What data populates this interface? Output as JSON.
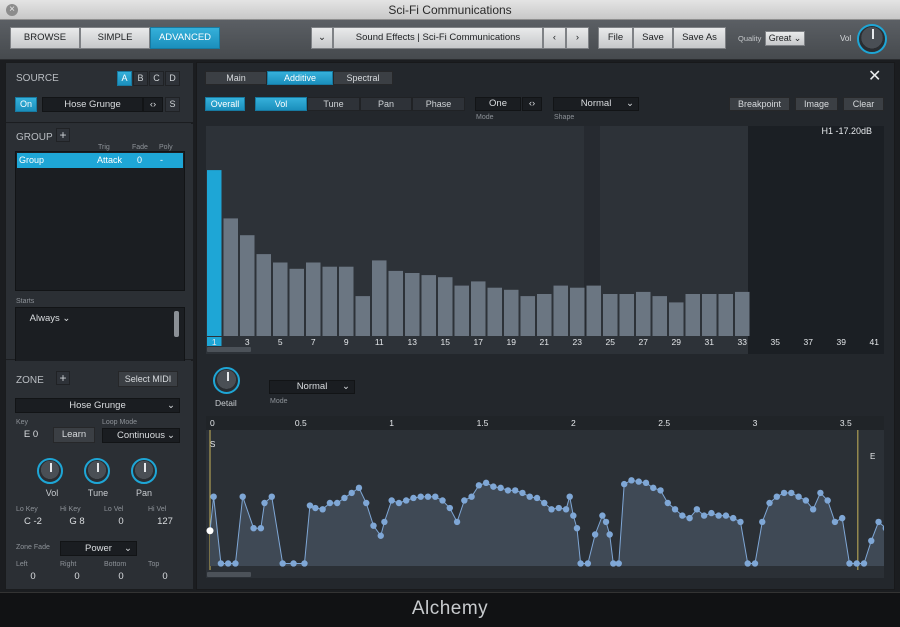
{
  "window": {
    "title": "Sci-Fi Communications"
  },
  "topbar": {
    "tabs": [
      "BROWSE",
      "SIMPLE",
      "ADVANCED"
    ],
    "preset_name": "Sound Effects | Sci-Fi Communications",
    "file_label": "File",
    "save_label": "Save",
    "save_as_label": "Save As",
    "quality_label": "Quality",
    "quality_value": "Great",
    "vol_label": "Vol"
  },
  "source": {
    "heading": "SOURCE",
    "slots": [
      "A",
      "B",
      "C",
      "D"
    ],
    "on_label": "On",
    "source_name": "Hose Grunge",
    "s_label": "S"
  },
  "group": {
    "heading": "GROUP",
    "col_trig": "Trig",
    "col_fade": "Fade",
    "col_poly": "Poly",
    "row": {
      "name": "Group",
      "trig": "Attack",
      "fade": "0",
      "poly": "-"
    },
    "starts_label": "Starts",
    "starts_value": "Always"
  },
  "zone": {
    "heading": "ZONE",
    "select_midi": "Select MIDI",
    "zone_name": "Hose Grunge",
    "key_label": "Key",
    "key_value": "E 0",
    "learn_label": "Learn",
    "loop_mode_label": "Loop Mode",
    "loop_mode_value": "Continuous",
    "knobs": [
      "Vol",
      "Tune",
      "Pan"
    ],
    "lo_key_label": "Lo Key",
    "lo_key_value": "C -2",
    "hi_key_label": "Hi Key",
    "hi_key_value": "G 8",
    "lo_vel_label": "Lo Vel",
    "lo_vel_value": "0",
    "hi_vel_label": "Hi Vel",
    "hi_vel_value": "127",
    "zone_fade_label": "Zone Fade",
    "zone_fade_value": "Power",
    "left_label": "Left",
    "left_value": "0",
    "right_label": "Right",
    "right_value": "0",
    "bottom_label": "Bottom",
    "bottom_value": "0",
    "top_label": "Top",
    "top_value": "0"
  },
  "editor": {
    "tabs": [
      "Main",
      "Additive",
      "Spectral"
    ],
    "subtabs": [
      "Overall",
      "Vol",
      "Tune",
      "Pan",
      "Phase"
    ],
    "mode_value": "One",
    "mode_label": "Mode",
    "shape_value": "Normal",
    "shape_label": "Shape",
    "breakpoint_label": "Breakpoint",
    "image_label": "Image",
    "clear_label": "Clear",
    "harmonic_readout": "H1 -17.20dB",
    "harmonic_axis_labels": [
      "1",
      "3",
      "5",
      "7",
      "9",
      "11",
      "13",
      "15",
      "17",
      "19",
      "21",
      "23",
      "25",
      "27",
      "29",
      "31",
      "33",
      "35",
      "37",
      "39",
      "41"
    ],
    "harmonic_levels": [
      0.79,
      0.56,
      0.48,
      0.39,
      0.35,
      0.32,
      0.35,
      0.33,
      0.33,
      0.19,
      0.36,
      0.31,
      0.3,
      0.29,
      0.28,
      0.24,
      0.26,
      0.23,
      0.22,
      0.19,
      0.2,
      0.24,
      0.23,
      0.24,
      0.2,
      0.2,
      0.21,
      0.19,
      0.16,
      0.2,
      0.2,
      0.2,
      0.21,
      0,
      0,
      0,
      0,
      0,
      0,
      0,
      0
    ],
    "detail_label": "Detail",
    "mode2_value": "Normal",
    "mode2_label": "Mode",
    "timeline_labels": [
      "0",
      "0.5",
      "1",
      "1.5",
      "2",
      "2.5",
      "3",
      "3.5"
    ],
    "start_marker": "S",
    "end_marker": "E",
    "envelope_points": [
      [
        0,
        0.28
      ],
      [
        0.02,
        0.55
      ],
      [
        0.06,
        0.02
      ],
      [
        0.1,
        0.02
      ],
      [
        0.14,
        0.02
      ],
      [
        0.18,
        0.55
      ],
      [
        0.24,
        0.3
      ],
      [
        0.28,
        0.3
      ],
      [
        0.3,
        0.5
      ],
      [
        0.34,
        0.55
      ],
      [
        0.4,
        0.02
      ],
      [
        0.46,
        0.02
      ],
      [
        0.52,
        0.02
      ],
      [
        0.55,
        0.48
      ],
      [
        0.58,
        0.46
      ],
      [
        0.62,
        0.45
      ],
      [
        0.66,
        0.5
      ],
      [
        0.7,
        0.5
      ],
      [
        0.74,
        0.54
      ],
      [
        0.78,
        0.58
      ],
      [
        0.82,
        0.62
      ],
      [
        0.86,
        0.5
      ],
      [
        0.9,
        0.32
      ],
      [
        0.94,
        0.24
      ],
      [
        0.96,
        0.35
      ],
      [
        1.0,
        0.52
      ],
      [
        1.04,
        0.5
      ],
      [
        1.08,
        0.52
      ],
      [
        1.12,
        0.54
      ],
      [
        1.16,
        0.55
      ],
      [
        1.2,
        0.55
      ],
      [
        1.24,
        0.55
      ],
      [
        1.28,
        0.52
      ],
      [
        1.32,
        0.46
      ],
      [
        1.36,
        0.35
      ],
      [
        1.4,
        0.52
      ],
      [
        1.44,
        0.55
      ],
      [
        1.48,
        0.64
      ],
      [
        1.52,
        0.66
      ],
      [
        1.56,
        0.63
      ],
      [
        1.6,
        0.62
      ],
      [
        1.64,
        0.6
      ],
      [
        1.68,
        0.6
      ],
      [
        1.72,
        0.58
      ],
      [
        1.76,
        0.55
      ],
      [
        1.8,
        0.54
      ],
      [
        1.84,
        0.5
      ],
      [
        1.88,
        0.45
      ],
      [
        1.92,
        0.46
      ],
      [
        1.96,
        0.45
      ],
      [
        1.98,
        0.55
      ],
      [
        2.0,
        0.4
      ],
      [
        2.02,
        0.3
      ],
      [
        2.04,
        0.02
      ],
      [
        2.08,
        0.02
      ],
      [
        2.12,
        0.25
      ],
      [
        2.16,
        0.4
      ],
      [
        2.18,
        0.35
      ],
      [
        2.2,
        0.25
      ],
      [
        2.22,
        0.02
      ],
      [
        2.25,
        0.02
      ],
      [
        2.28,
        0.65
      ],
      [
        2.32,
        0.68
      ],
      [
        2.36,
        0.67
      ],
      [
        2.4,
        0.66
      ],
      [
        2.44,
        0.62
      ],
      [
        2.48,
        0.6
      ],
      [
        2.52,
        0.5
      ],
      [
        2.56,
        0.45
      ],
      [
        2.6,
        0.4
      ],
      [
        2.64,
        0.38
      ],
      [
        2.68,
        0.45
      ],
      [
        2.72,
        0.4
      ],
      [
        2.76,
        0.42
      ],
      [
        2.8,
        0.4
      ],
      [
        2.84,
        0.4
      ],
      [
        2.88,
        0.38
      ],
      [
        2.92,
        0.35
      ],
      [
        2.96,
        0.02
      ],
      [
        3.0,
        0.02
      ],
      [
        3.04,
        0.35
      ],
      [
        3.08,
        0.5
      ],
      [
        3.12,
        0.55
      ],
      [
        3.16,
        0.58
      ],
      [
        3.2,
        0.58
      ],
      [
        3.24,
        0.55
      ],
      [
        3.28,
        0.52
      ],
      [
        3.32,
        0.45
      ],
      [
        3.36,
        0.58
      ],
      [
        3.4,
        0.52
      ],
      [
        3.44,
        0.35
      ],
      [
        3.48,
        0.38
      ],
      [
        3.52,
        0.02
      ],
      [
        3.56,
        0.02
      ],
      [
        3.6,
        0.02
      ],
      [
        3.64,
        0.2
      ],
      [
        3.68,
        0.35
      ],
      [
        3.72,
        0.3
      ],
      [
        3.76,
        0.02
      ]
    ]
  },
  "footer": {
    "brand": "Alchemy"
  },
  "colors": {
    "accent": "#1ea6d6",
    "bar": "#6b7682",
    "envelope": "#7fa7d6"
  }
}
